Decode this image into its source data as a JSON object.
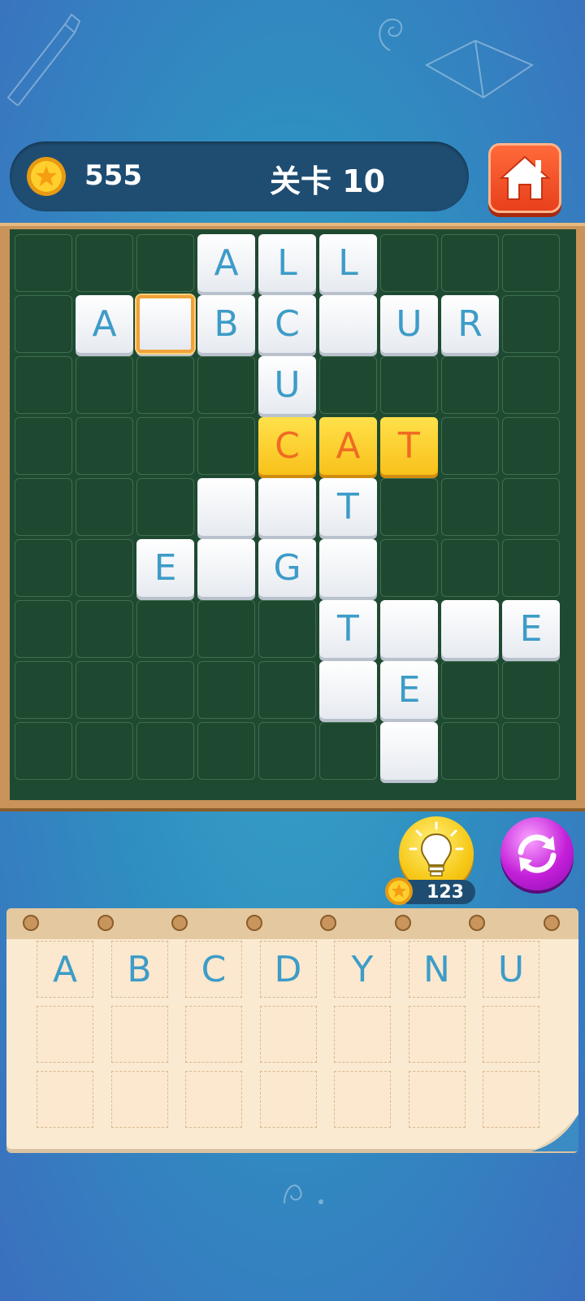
{
  "header": {
    "coins": "555",
    "level_label": "关卡 10",
    "home_icon": "home-icon"
  },
  "colors": {
    "board_bg": "#1f4a32",
    "tile_letter": "#3d9cc8",
    "highlight_tile": "#f9c11b",
    "highlight_letter": "#f06a23"
  },
  "board": {
    "rows": 9,
    "cols": 9,
    "tiles": [
      {
        "r": 0,
        "c": 3,
        "letter": "A"
      },
      {
        "r": 0,
        "c": 4,
        "letter": "L"
      },
      {
        "r": 0,
        "c": 5,
        "letter": "L"
      },
      {
        "r": 1,
        "c": 1,
        "letter": "A"
      },
      {
        "r": 1,
        "c": 2,
        "letter": "",
        "selected": true
      },
      {
        "r": 1,
        "c": 3,
        "letter": "B"
      },
      {
        "r": 1,
        "c": 4,
        "letter": "C"
      },
      {
        "r": 1,
        "c": 5,
        "letter": ""
      },
      {
        "r": 1,
        "c": 6,
        "letter": "U"
      },
      {
        "r": 1,
        "c": 7,
        "letter": "R"
      },
      {
        "r": 2,
        "c": 4,
        "letter": "U"
      },
      {
        "r": 3,
        "c": 4,
        "letter": "C",
        "highlight": true
      },
      {
        "r": 3,
        "c": 5,
        "letter": "A",
        "highlight": true
      },
      {
        "r": 3,
        "c": 6,
        "letter": "T",
        "highlight": true
      },
      {
        "r": 4,
        "c": 3,
        "letter": ""
      },
      {
        "r": 4,
        "c": 4,
        "letter": ""
      },
      {
        "r": 4,
        "c": 5,
        "letter": "T"
      },
      {
        "r": 5,
        "c": 2,
        "letter": "E"
      },
      {
        "r": 5,
        "c": 3,
        "letter": ""
      },
      {
        "r": 5,
        "c": 4,
        "letter": "G"
      },
      {
        "r": 5,
        "c": 5,
        "letter": ""
      },
      {
        "r": 6,
        "c": 5,
        "letter": "T"
      },
      {
        "r": 6,
        "c": 6,
        "letter": ""
      },
      {
        "r": 6,
        "c": 7,
        "letter": ""
      },
      {
        "r": 6,
        "c": 8,
        "letter": "E"
      },
      {
        "r": 7,
        "c": 5,
        "letter": ""
      },
      {
        "r": 7,
        "c": 6,
        "letter": "E"
      },
      {
        "r": 8,
        "c": 6,
        "letter": ""
      }
    ]
  },
  "hint": {
    "cost": "123",
    "icon": "lightbulb-icon"
  },
  "refresh": {
    "icon": "refresh-icon"
  },
  "tray": {
    "rows": [
      [
        "A",
        "B",
        "C",
        "D",
        "Y",
        "N",
        "U"
      ],
      [
        "",
        "",
        "",
        "",
        "",
        "",
        ""
      ],
      [
        "",
        "",
        "",
        "",
        "",
        "",
        ""
      ]
    ]
  }
}
